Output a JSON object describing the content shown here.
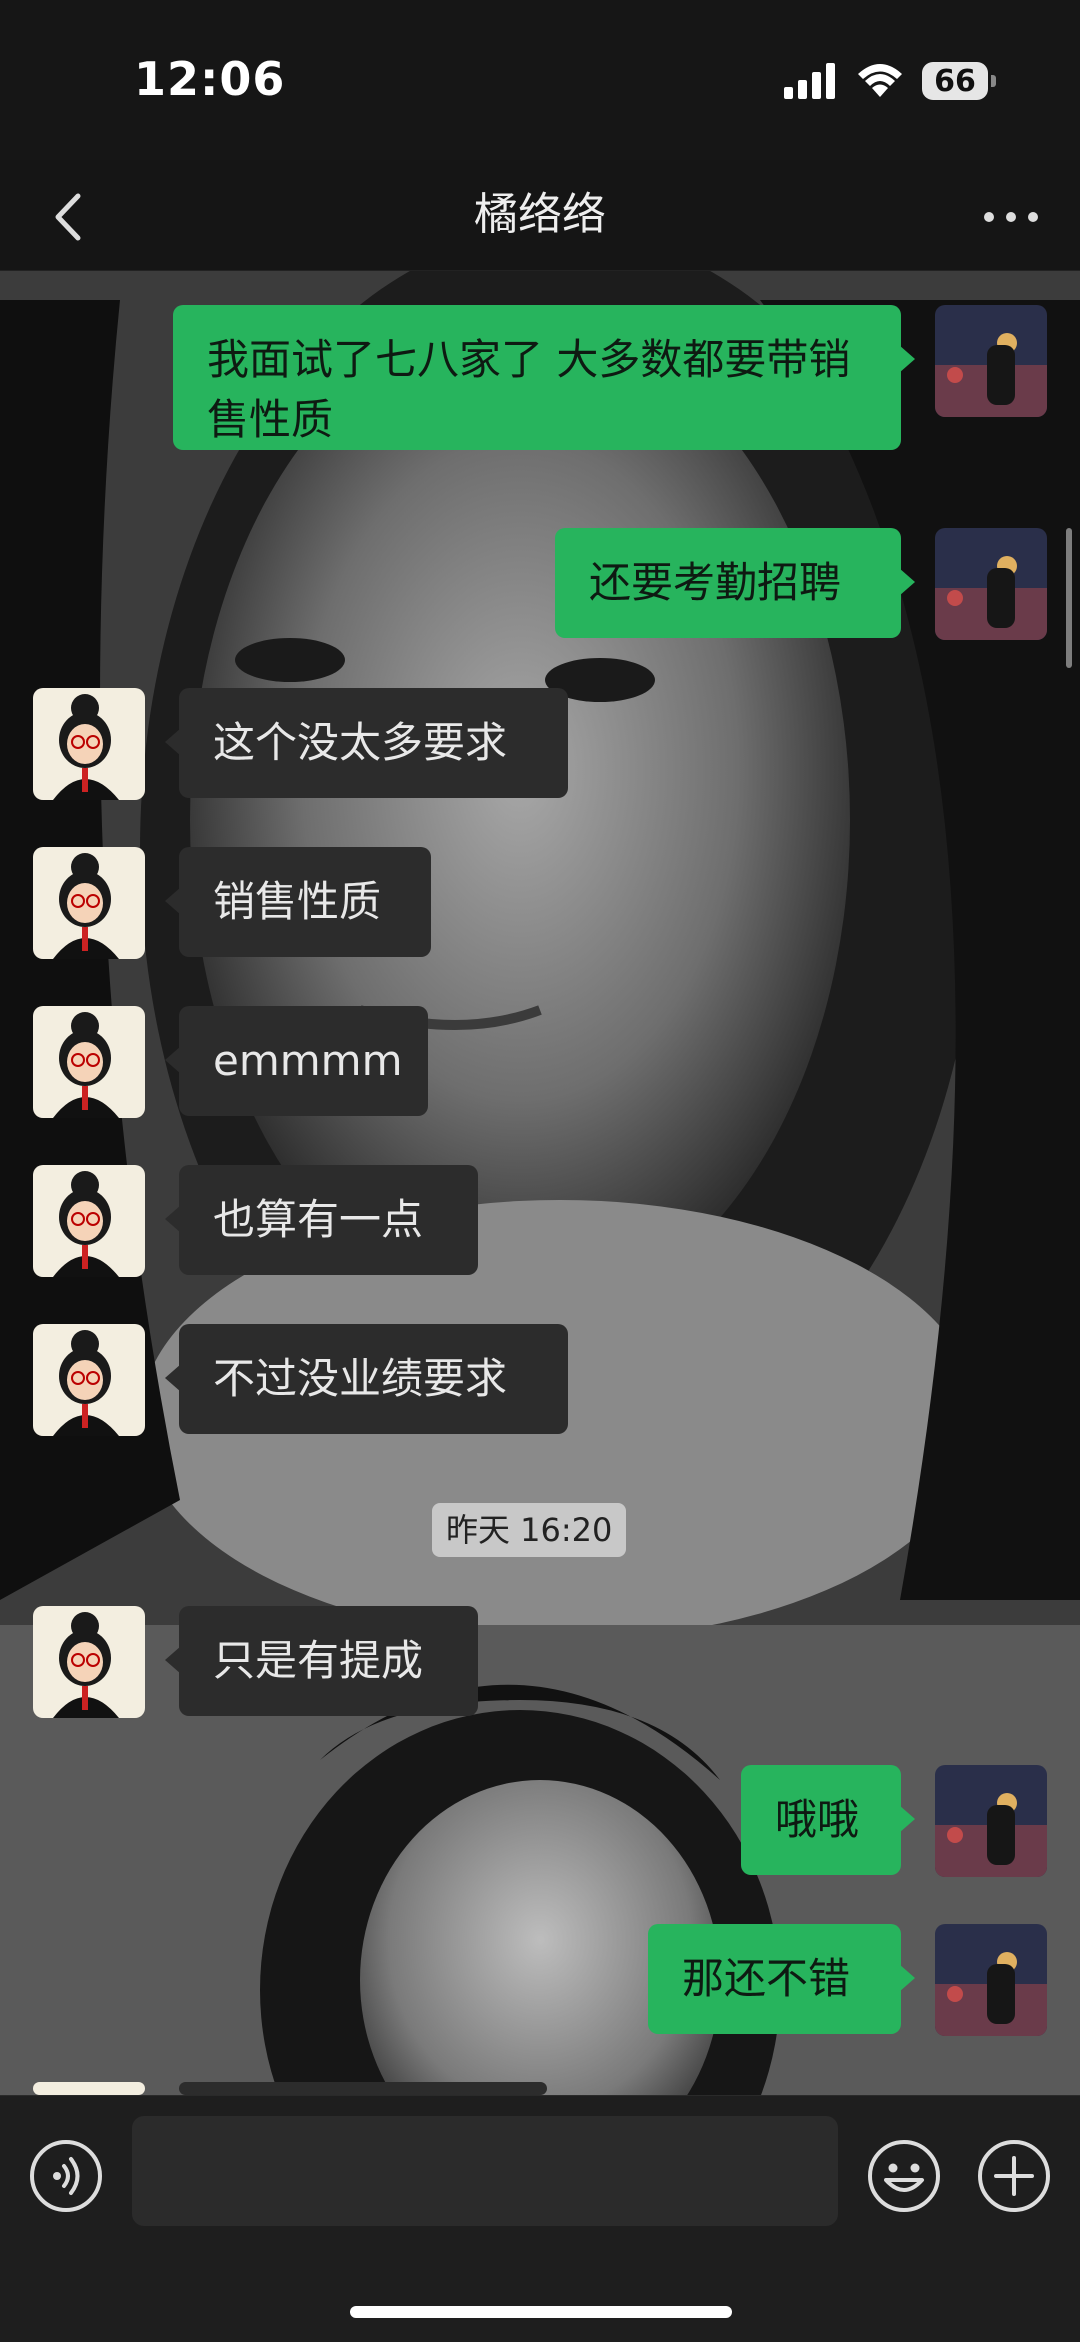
{
  "status_bar": {
    "time": "12:06",
    "battery_level": "66"
  },
  "header": {
    "title": "橘络络",
    "back_icon": "chevron-left-icon",
    "more_icon": "more-dots-icon"
  },
  "messages": [
    {
      "direction": "outgoing",
      "text": "我面试了七八家了 大多数都要带销售性质"
    },
    {
      "direction": "outgoing",
      "text": "还要考勤招聘"
    },
    {
      "direction": "incoming",
      "text": "这个没太多要求"
    },
    {
      "direction": "incoming",
      "text": "销售性质"
    },
    {
      "direction": "incoming",
      "text": "emmmm"
    },
    {
      "direction": "incoming",
      "text": "也算有一点"
    },
    {
      "direction": "incoming",
      "text": "不过没业绩要求"
    },
    {
      "direction": "incoming",
      "text": "只是有提成"
    },
    {
      "direction": "outgoing",
      "text": "哦哦"
    },
    {
      "direction": "outgoing",
      "text": "那还不错"
    }
  ],
  "timestamp_divider": "昨天 16:20",
  "input_bar": {
    "voice_icon": "voice-icon",
    "emoji_icon": "emoji-icon",
    "plus_icon": "plus-icon",
    "placeholder": ""
  },
  "colors": {
    "outgoing_bubble": "#27b45d",
    "incoming_bubble": "#2c2c2c",
    "background": "#141414"
  }
}
